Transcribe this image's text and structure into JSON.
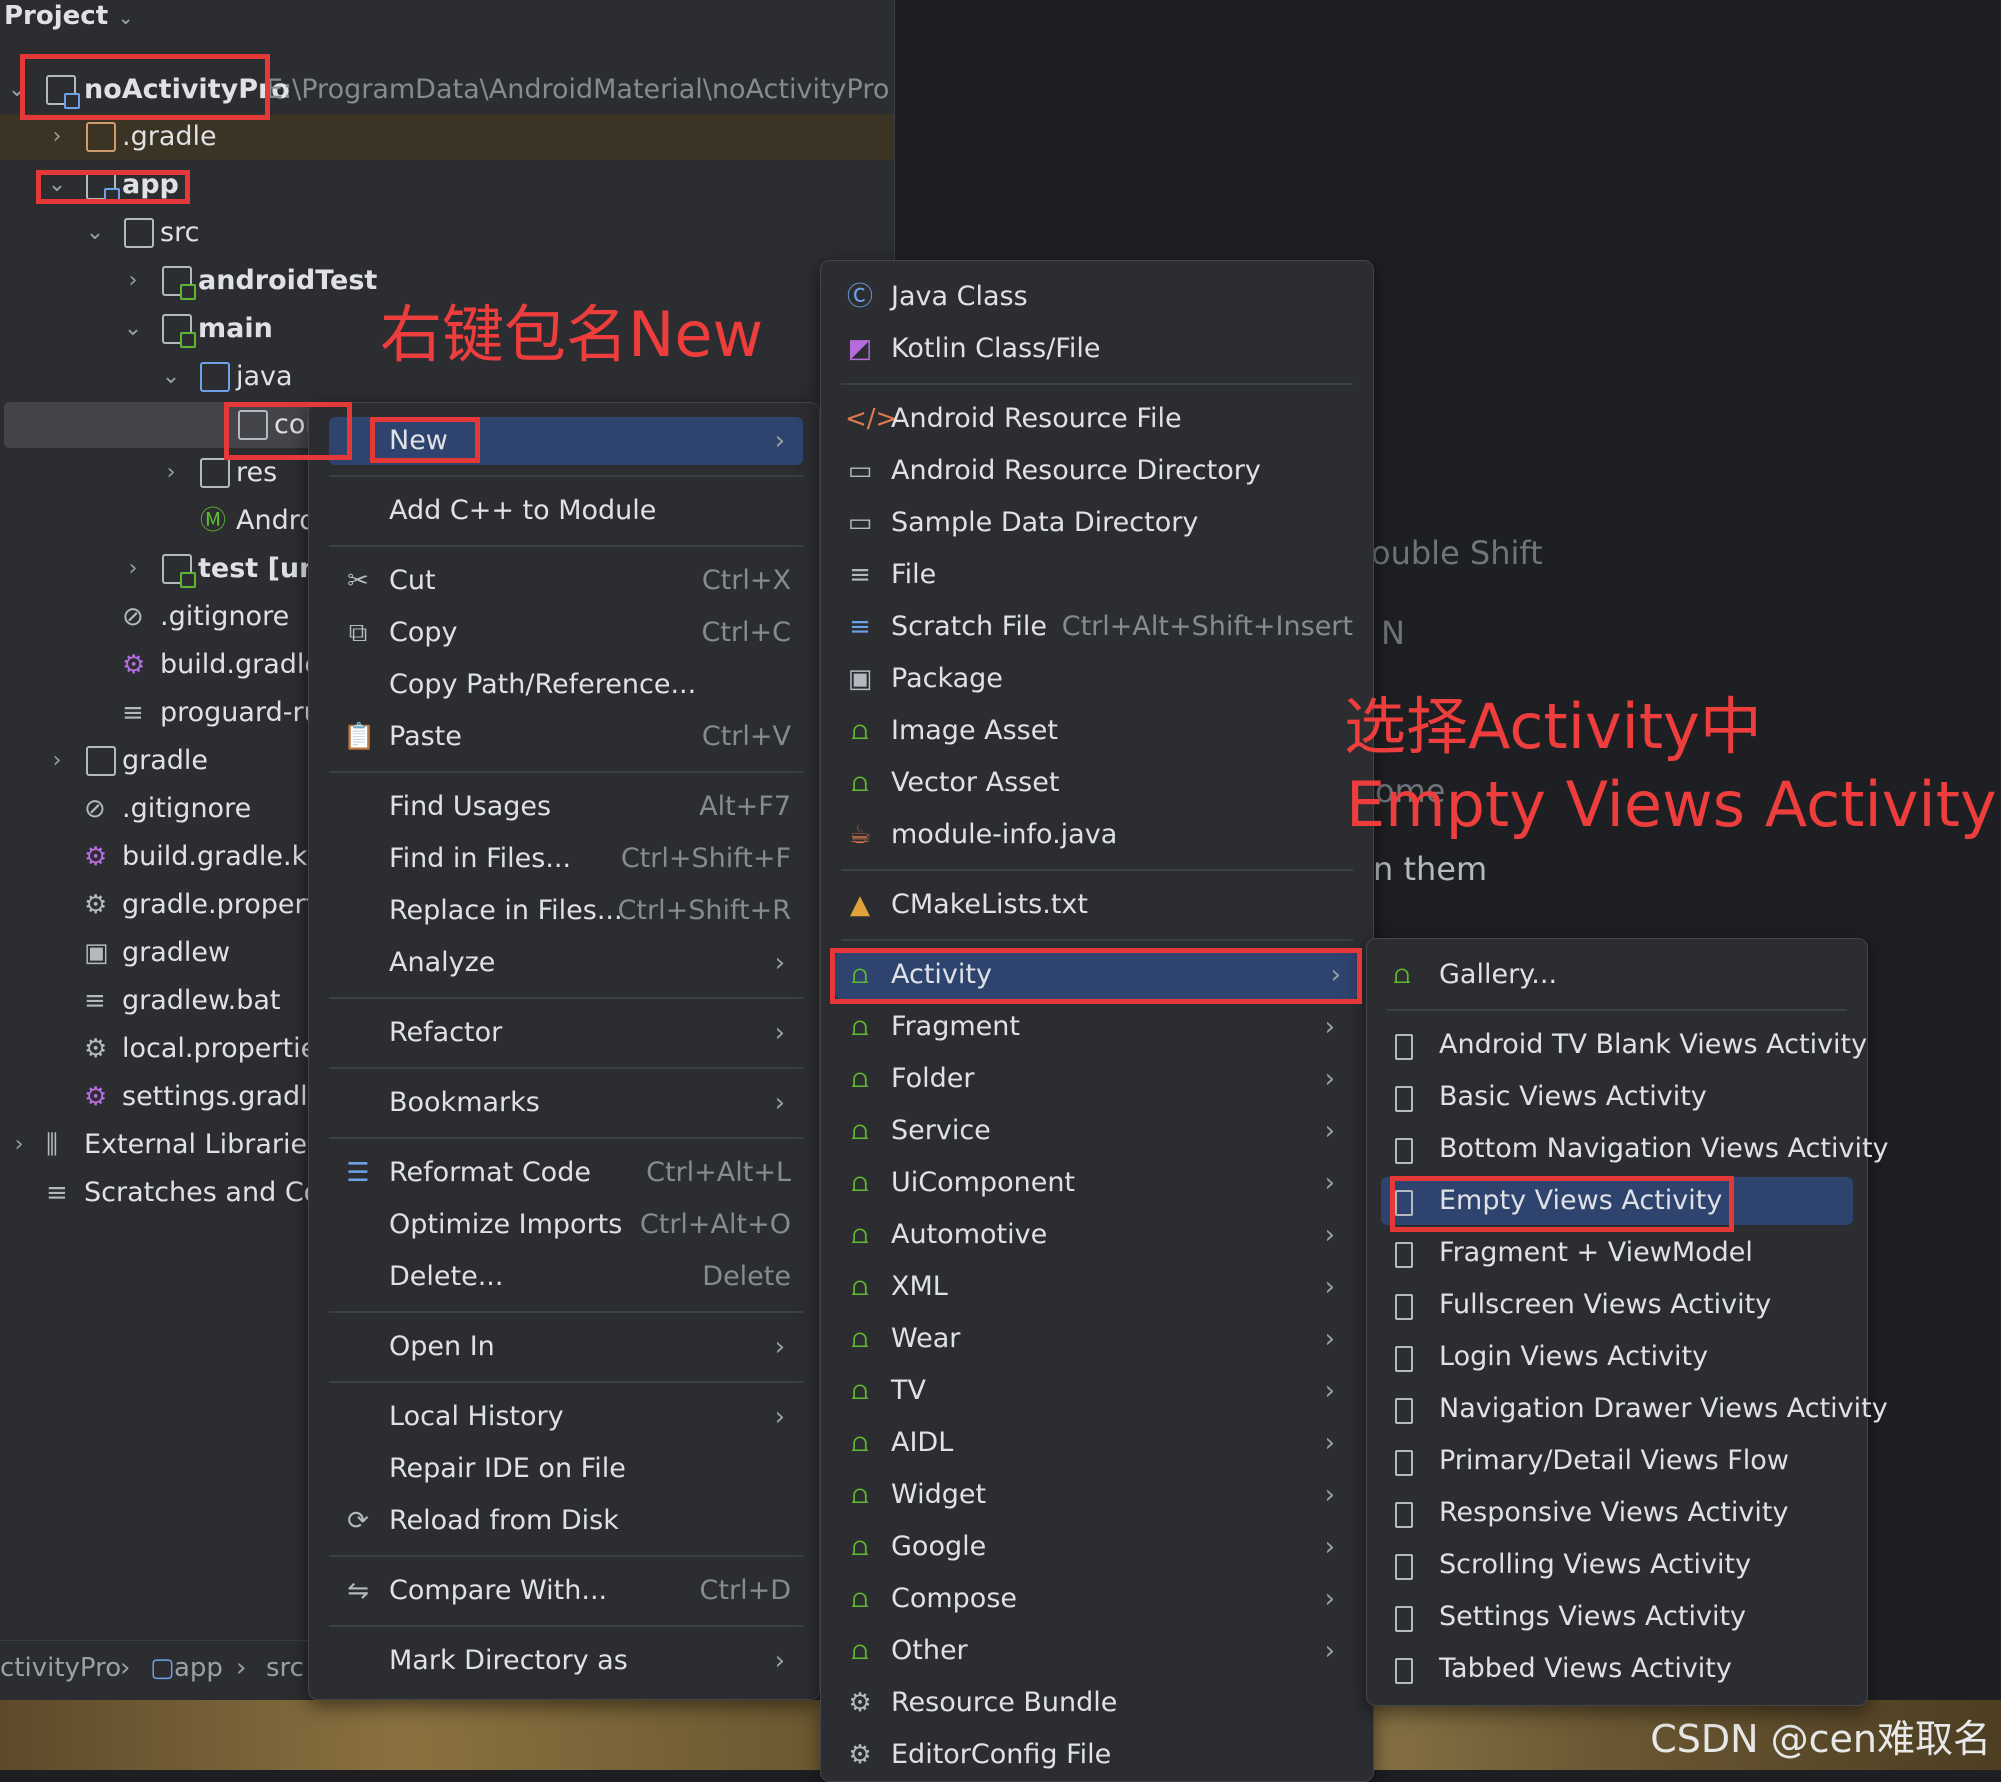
{
  "project_panel": {
    "title": "Project",
    "tree": [
      {
        "label": "noActivityPro",
        "path": "E:\\ProgramData\\AndroidMaterial\\noActivityPro"
      },
      {
        "label": ".gradle"
      },
      {
        "label": "app"
      },
      {
        "label": "src"
      },
      {
        "label": "androidTest"
      },
      {
        "label": "main"
      },
      {
        "label": "java"
      },
      {
        "label": "cor"
      },
      {
        "label": "res"
      },
      {
        "label": "Andro"
      },
      {
        "label": "test [unit"
      },
      {
        "label": ".gitignore"
      },
      {
        "label": "build.gradle.k"
      },
      {
        "label": "proguard-rul"
      },
      {
        "label": "gradle"
      },
      {
        "label": ".gitignore"
      },
      {
        "label": "build.gradle.kts"
      },
      {
        "label": "gradle.propertie"
      },
      {
        "label": "gradlew"
      },
      {
        "label": "gradlew.bat"
      },
      {
        "label": "local.properties"
      },
      {
        "label": "settings.gradle.k"
      },
      {
        "label": "External Libraries"
      },
      {
        "label": "Scratches and Cons"
      }
    ]
  },
  "breadcrumb": [
    "ctivityPro",
    "app",
    "src"
  ],
  "editor_hints": [
    "ouble Shift",
    "N",
    "ome",
    "n them"
  ],
  "context_menu": [
    {
      "label": "New"
    },
    {
      "label": "Add C++ to Module"
    },
    {
      "label": "Cut",
      "shortcut": "Ctrl+X"
    },
    {
      "label": "Copy",
      "shortcut": "Ctrl+C"
    },
    {
      "label": "Copy Path/Reference..."
    },
    {
      "label": "Paste",
      "shortcut": "Ctrl+V"
    },
    {
      "label": "Find Usages",
      "shortcut": "Alt+F7"
    },
    {
      "label": "Find in Files...",
      "shortcut": "Ctrl+Shift+F"
    },
    {
      "label": "Replace in Files...",
      "shortcut": "Ctrl+Shift+R"
    },
    {
      "label": "Analyze"
    },
    {
      "label": "Refactor"
    },
    {
      "label": "Bookmarks"
    },
    {
      "label": "Reformat Code",
      "shortcut": "Ctrl+Alt+L"
    },
    {
      "label": "Optimize Imports",
      "shortcut": "Ctrl+Alt+O"
    },
    {
      "label": "Delete...",
      "shortcut": "Delete"
    },
    {
      "label": "Open In"
    },
    {
      "label": "Local History"
    },
    {
      "label": "Repair IDE on File"
    },
    {
      "label": "Reload from Disk"
    },
    {
      "label": "Compare With...",
      "shortcut": "Ctrl+D"
    },
    {
      "label": "Mark Directory as"
    }
  ],
  "new_menu": [
    {
      "label": "Java Class"
    },
    {
      "label": "Kotlin Class/File"
    },
    {
      "label": "Android Resource File"
    },
    {
      "label": "Android Resource Directory"
    },
    {
      "label": "Sample Data Directory"
    },
    {
      "label": "File"
    },
    {
      "label": "Scratch File",
      "shortcut": "Ctrl+Alt+Shift+Insert"
    },
    {
      "label": "Package"
    },
    {
      "label": "Image Asset"
    },
    {
      "label": "Vector Asset"
    },
    {
      "label": "module-info.java"
    },
    {
      "label": "CMakeLists.txt"
    },
    {
      "label": "Activity"
    },
    {
      "label": "Fragment"
    },
    {
      "label": "Folder"
    },
    {
      "label": "Service"
    },
    {
      "label": "UiComponent"
    },
    {
      "label": "Automotive"
    },
    {
      "label": "XML"
    },
    {
      "label": "Wear"
    },
    {
      "label": "TV"
    },
    {
      "label": "AIDL"
    },
    {
      "label": "Widget"
    },
    {
      "label": "Google"
    },
    {
      "label": "Compose"
    },
    {
      "label": "Other"
    },
    {
      "label": "Resource Bundle"
    },
    {
      "label": "EditorConfig File"
    }
  ],
  "activity_menu": [
    {
      "label": "Gallery..."
    },
    {
      "label": "Android TV Blank Views Activity"
    },
    {
      "label": "Basic Views Activity"
    },
    {
      "label": "Bottom Navigation Views Activity"
    },
    {
      "label": "Empty Views Activity"
    },
    {
      "label": "Fragment + ViewModel"
    },
    {
      "label": "Fullscreen Views Activity"
    },
    {
      "label": "Login Views Activity"
    },
    {
      "label": "Navigation Drawer Views Activity"
    },
    {
      "label": "Primary/Detail Views Flow"
    },
    {
      "label": "Responsive Views Activity"
    },
    {
      "label": "Scrolling Views Activity"
    },
    {
      "label": "Settings Views Activity"
    },
    {
      "label": "Tabbed Views Activity"
    }
  ],
  "annotations": {
    "right_click": "右键包名New",
    "choose_line1": "选择Activity中",
    "choose_line2": "Empty Views Activity"
  },
  "watermark": "CSDN @cen难取名",
  "colors": {
    "selection": "#2e436e",
    "annotation_red": "#ee3d3d",
    "android_green": "#5fb832"
  }
}
